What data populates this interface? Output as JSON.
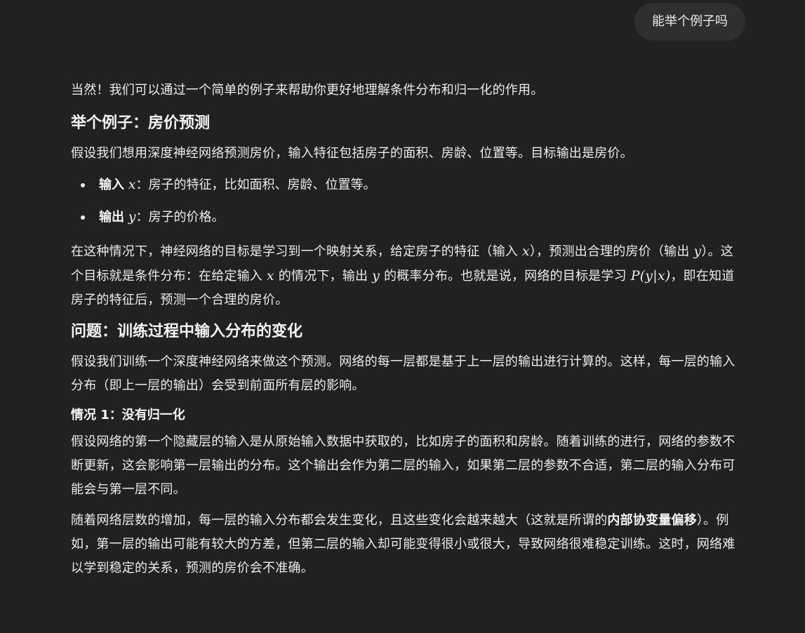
{
  "user_message": "能举个例子吗",
  "reply": {
    "intro": "当然！我们可以通过一个简单的例子来帮助你更好地理解条件分布和归一化的作用。",
    "section1": {
      "heading": "举个例子：房价预测",
      "para": "假设我们想用深度神经网络预测房价，输入特征包括房子的面积、房龄、位置等。目标输出是房价。",
      "bullets": [
        {
          "label": "输入",
          "var": "x",
          "text": "：房子的特征，比如面积、房龄、位置等。"
        },
        {
          "label": "输出",
          "var": "y",
          "text": "：房子的价格。"
        }
      ],
      "para2": {
        "t1": "在这种情况下，神经网络的目标是学习到一个映射关系，给定房子的特征（输入 ",
        "v1": "x",
        "t2": "），预测出合理的房价（输出 ",
        "v2": "y",
        "t3": "）。这个目标就是条件分布：在给定输入 ",
        "v3": "x",
        "t4": " 的情况下，输出 ",
        "v4": "y",
        "t5": " 的概率分布。也就是说，网络的目标是学习 ",
        "formula": "P(y|x)",
        "t6": "，即在知道房子的特征后，预测一个合理的房价。"
      }
    },
    "section2": {
      "heading": "问题：训练过程中输入分布的变化",
      "para": "假设我们训练一个深度神经网络来做这个预测。网络的每一层都是基于上一层的输出进行计算的。这样，每一层的输入分布（即上一层的输出）会受到前面所有层的影响。",
      "sub": {
        "heading": "情况 1：没有归一化",
        "para1": "假设网络的第一个隐藏层的输入是从原始输入数据中获取的，比如房子的面积和房龄。随着训练的进行，网络的参数不断更新，这会影响第一层输出的分布。这个输出会作为第二层的输入，如果第二层的参数不合适，第二层的输入分布可能会与第一层不同。",
        "para2_a": "随着网络层数的增加，每一层的输入分布都会发生变化，且这些变化会越来越大（这就是所谓的",
        "para2_bold": "内部协变量偏移",
        "para2_b": "）。例如，第一层的输出可能有较大的方差，但第二层的输入却可能变得很小或很大，导致网络很难稳定训练。这时，网络难以学到稳定的关系，预测的房价会不准确。"
      }
    }
  }
}
